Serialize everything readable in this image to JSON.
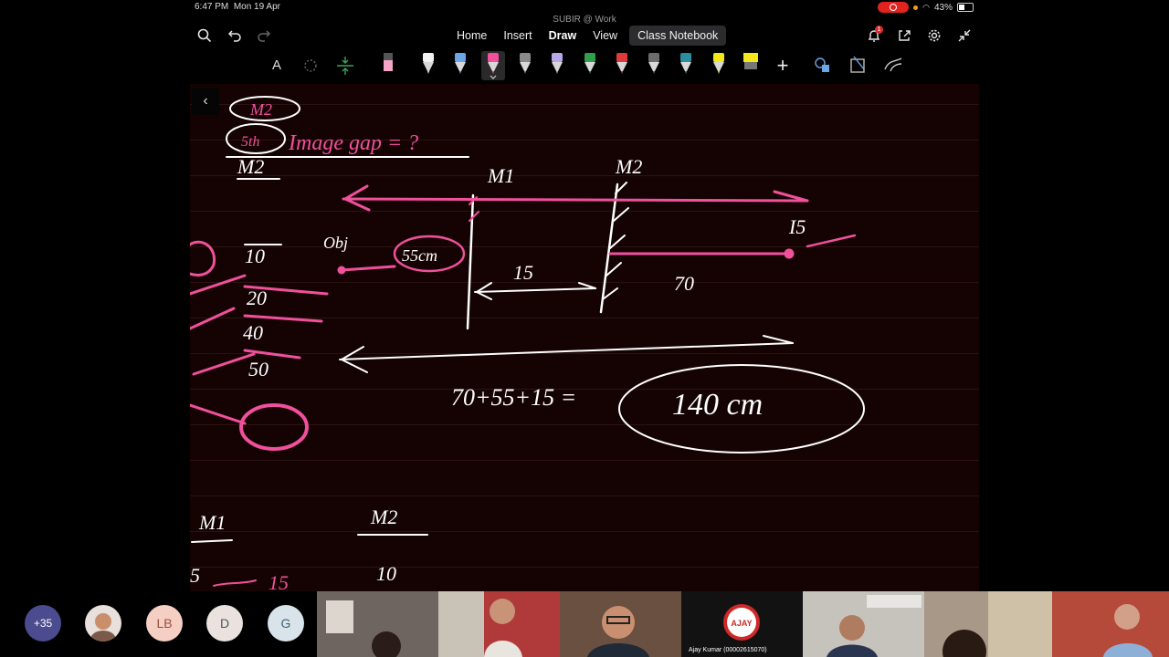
{
  "status_bar": {
    "time": "6:47 PM",
    "date": "Mon 19 Apr",
    "battery": "43%"
  },
  "app": {
    "title": "SUBIR @ Work"
  },
  "tabs": [
    {
      "label": "Home"
    },
    {
      "label": "Insert"
    },
    {
      "label": "Draw",
      "active": true
    },
    {
      "label": "View"
    },
    {
      "label": "Class Notebook"
    }
  ],
  "notifications": {
    "count": "1"
  },
  "toolbar": {
    "text_tool_label": "A"
  },
  "pens": [
    {
      "color": "#f2f2f2",
      "icon": "pen-icon"
    },
    {
      "color": "#6aa6e8",
      "icon": "pen-icon"
    },
    {
      "color": "#f0509c",
      "icon": "pen-icon",
      "selected": true
    },
    {
      "color": "#8a8a8a",
      "icon": "pen-icon"
    },
    {
      "color": "#b7a6e8",
      "icon": "pen-icon"
    },
    {
      "color": "#2f9e4e",
      "icon": "pen-icon"
    },
    {
      "color": "#e03b3b",
      "icon": "pen-icon"
    },
    {
      "color": "#6d6d6d",
      "icon": "pen-icon"
    },
    {
      "color": "#2b8e9e",
      "icon": "pen-icon"
    },
    {
      "color": "#f2e81a",
      "icon": "pen-icon"
    },
    {
      "color": "#f4e81c",
      "icon": "highlighter-icon"
    }
  ],
  "participants": {
    "more_count": "+35",
    "avatars": [
      {
        "label": "",
        "bg": "#e8e0dc",
        "type": "photo"
      },
      {
        "label": "LB",
        "bg": "#f6cfc4",
        "color": "#9a4c40"
      },
      {
        "label": "D",
        "bg": "#e9e2de",
        "color": "#555555"
      },
      {
        "label": "G",
        "bg": "#d9e4ea",
        "color": "#40606f"
      }
    ],
    "videos": [
      {
        "caption": "",
        "bg": "#6f6560"
      },
      {
        "caption": "",
        "bg": "#b03a3a"
      },
      {
        "caption": "",
        "bg": "#6a5040"
      },
      {
        "caption": "Ajay Kumar (00002615070)",
        "bg": "#121212",
        "logo": "AJAY"
      },
      {
        "caption": "",
        "bg": "#c6c2bc"
      },
      {
        "caption": "",
        "bg": "#a89888"
      }
    ]
  },
  "handwriting": {
    "m2_top": "M2",
    "fifth": "5th",
    "image_gap": "Image gap = ?",
    "m1_label": "M1",
    "m2_label": "M2",
    "m2_left": "M2",
    "is_label": "I5",
    "obj_label": "Obj",
    "obj_dist": "55cm",
    "d15": "15",
    "d70": "70",
    "v10": "10",
    "v20": "20",
    "v40": "40",
    "v50": "50",
    "sum": "70+55+15 =",
    "result": "140 cm",
    "m1_bottom": "M1",
    "m2_bottom": "M2",
    "b5": "5",
    "b15": "15",
    "b10": "10"
  }
}
